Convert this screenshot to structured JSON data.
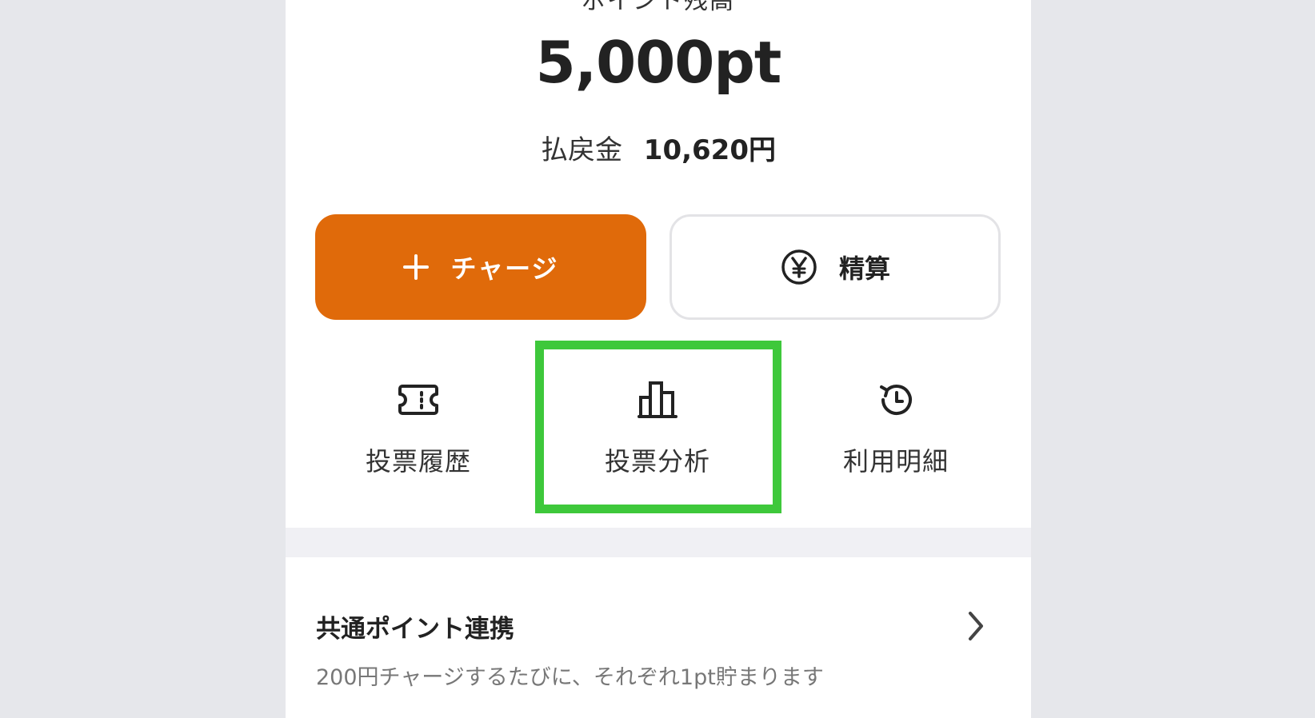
{
  "balance": {
    "label": "ポイント残高",
    "value": "5,000pt"
  },
  "refund": {
    "label": "払戻金",
    "amount": "10,620円"
  },
  "buttons": {
    "charge_label": "チャージ",
    "settle_label": "精算"
  },
  "actions": [
    {
      "label": "投票履歴",
      "icon": "ticket-icon"
    },
    {
      "label": "投票分析",
      "icon": "bar-chart-icon"
    },
    {
      "label": "利用明細",
      "icon": "history-clock-icon"
    }
  ],
  "common_points": {
    "title": "共通ポイント連携",
    "description": "200円チャージするたびに、それぞれ1pt貯まります"
  },
  "colors": {
    "accent": "#e06a0a",
    "highlight": "#3ec83b",
    "background": "#e6e7eb"
  }
}
